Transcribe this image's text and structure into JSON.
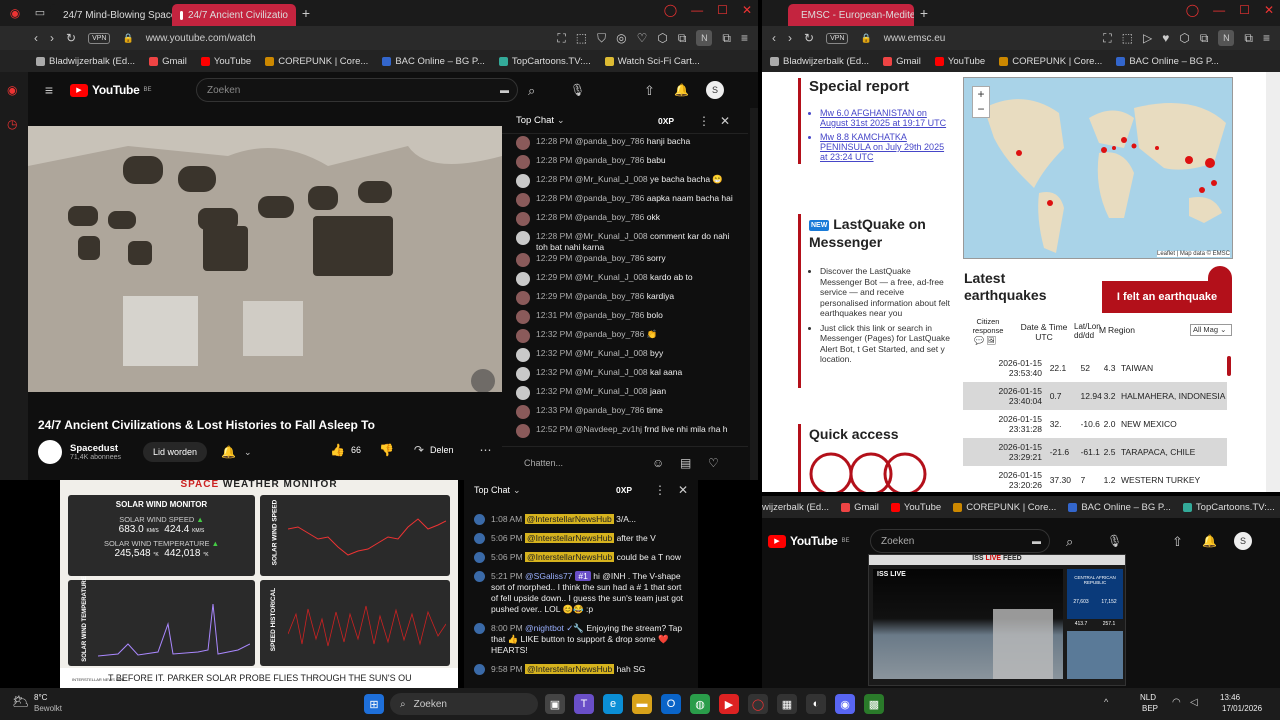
{
  "left_browser": {
    "tabs": [
      {
        "label": "24/7 Mind-Blowing Space"
      },
      {
        "label": "24/7 Ancient Civilizatio"
      }
    ],
    "url": "www.youtube.com/watch",
    "vpn": "VPN",
    "bookmarks": [
      "Bladwijzerbalk (Ed...",
      "Gmail",
      "YouTube",
      "COREPUNK | Core...",
      "BAC Online – BG P...",
      "TopCartoons.TV:...",
      "Watch Sci-Fi Cart..."
    ],
    "yt": {
      "logo": "YouTube",
      "region": "BE",
      "search_placeholder": "Zoeken",
      "avatar": "S",
      "video_title": "24/7 Ancient Civilizations & Lost Histories to Fall Asleep To",
      "channel": "Spacedust",
      "subscribers": "71,4K abonnees",
      "join": "Lid worden",
      "likes": "66",
      "share": "Delen",
      "chat": {
        "header": "Top Chat",
        "points": "0XP",
        "input_placeholder": "Chatten...",
        "messages": [
          {
            "time": "12:28 PM",
            "user": "@panda_boy_786",
            "text": "hanji bacha"
          },
          {
            "time": "12:28 PM",
            "user": "@panda_boy_786",
            "text": "babu"
          },
          {
            "time": "12:28 PM",
            "user": "@Mr_Kunal_J_008",
            "text": "ye bacha bacha 😁"
          },
          {
            "time": "12:28 PM",
            "user": "@panda_boy_786",
            "text": "aapka naam bacha hai"
          },
          {
            "time": "12:28 PM",
            "user": "@panda_boy_786",
            "text": "okk"
          },
          {
            "time": "12:28 PM",
            "user": "@Mr_Kunal_J_008",
            "text": "comment kar do nahi toh bat nahi karna"
          },
          {
            "time": "12:29 PM",
            "user": "@panda_boy_786",
            "text": "sorry"
          },
          {
            "time": "12:29 PM",
            "user": "@Mr_Kunal_J_008",
            "text": "kardo ab to"
          },
          {
            "time": "12:29 PM",
            "user": "@panda_boy_786",
            "text": "kardiya"
          },
          {
            "time": "12:31 PM",
            "user": "@panda_boy_786",
            "text": "bolo"
          },
          {
            "time": "12:32 PM",
            "user": "@panda_boy_786",
            "text": "👏"
          },
          {
            "time": "12:32 PM",
            "user": "@Mr_Kunal_J_008",
            "text": "byy"
          },
          {
            "time": "12:32 PM",
            "user": "@Mr_Kunal_J_008",
            "text": "kal aana"
          },
          {
            "time": "12:32 PM",
            "user": "@Mr_Kunal_J_008",
            "text": "jaan"
          },
          {
            "time": "12:33 PM",
            "user": "@panda_boy_786",
            "text": "time"
          },
          {
            "time": "12:52 PM",
            "user": "@Navdeep_zv1hj",
            "text": "frnd live nhi mila rha h"
          }
        ]
      }
    }
  },
  "space_monitor": {
    "title_a": "SPACE",
    "title_b": " WEATHER MONITOR",
    "solar_wind_monitor": "SOLAR WIND MONITOR",
    "speed_label": "SOLAR WIND SPEED",
    "speed_a": "683.0",
    "speed_b": "424.4",
    "speed_unit": "KM/S",
    "temp_label": "SOLAR WIND TEMPERATURE",
    "temp_a": "245,548",
    "temp_b": "442,018",
    "temp_unit": "°K",
    "chart1_axis": "SOLAR WIND SPEED",
    "chart1_yticks": [
      "700",
      "650",
      "600",
      "550",
      "500",
      "450",
      "400",
      "350"
    ],
    "chart1_xticks": [
      "Jan 5",
      "Jan 7",
      "Jan 9",
      "Jan 11"
    ],
    "chart2_axis": "SOLAR WIND TEMPERATURE",
    "chart2_xticks": [
      "Jan 5",
      "Jan 7",
      "Jan 9",
      "Jan 11"
    ],
    "chart3_axis": "SPEED HISTORICAL",
    "chart3_yticks": [
      "600",
      "500",
      "400",
      "300",
      "200"
    ],
    "chart3_xticks": [
      "1964",
      "1971",
      "1978",
      "1985",
      "1992",
      "1999",
      "2006",
      "2013",
      "2020"
    ],
    "ticker": "T BEFORE IT.   PARKER SOLAR PROBE FLIES THROUGH THE SUN'S OU",
    "brand": "INTERSTELLAR NEWS HUB"
  },
  "bottom_chat": {
    "header": "Top Chat",
    "points": "0XP",
    "messages": [
      {
        "time": "1:08 AM",
        "user": "@InterstellarNewsHub",
        "text": "3/A..."
      },
      {
        "time": "5:06 PM",
        "user": "@InterstellarNewsHub",
        "text": "after the V"
      },
      {
        "time": "5:06 PM",
        "user": "@InterstellarNewsHub",
        "text": "could be a T now"
      },
      {
        "time": "5:21 PM",
        "user": "@SGaliss77",
        "badge": "#1",
        "text": "hi @INH . The V-shape sort of morphed.. I think the sun had a # 1 that sort of fell upside down.. I guess the sun's team just got pushed over.. LOL 😊😂 :p"
      },
      {
        "time": "8:00 PM",
        "user": "@nightbot ✓🔧",
        "text": "Enjoying the stream? Tap that 👍 LIKE button to support & drop some ❤️ HEARTS!"
      },
      {
        "time": "9:58 PM",
        "user": "@InterstellarNewsHub",
        "text": "hah SG"
      }
    ]
  },
  "right_browser": {
    "tab": "EMSC - European-Mediter",
    "url": "www.emsc.eu",
    "vpn": "VPN",
    "bookmarks": [
      "Bladwijzerbalk (Ed...",
      "Gmail",
      "YouTube",
      "COREPUNK | Core...",
      "BAC Online – BG P..."
    ],
    "special_report": "Special report",
    "report_links": [
      "Mw 6.0 AFGHANISTAN on August 31st 2025 at 19:17 UTC",
      "Mw 8.8 KAMCHATKA PENINSULA on July 29th 2025 at 23:24 UTC"
    ],
    "lastquake_title": "LastQuake on Messenger",
    "new_badge": "NEW",
    "lastquake_b1": "Discover the LastQuake Messenger Bot — a free, ad-free service — and receive personalised information about felt earthquakes near you",
    "lastquake_b2": "Just click this link or search in Messenger (Pages) for LastQuake Alert Bot, t Get Started, and set y location.",
    "quick_access": "Quick access",
    "map_zoom": "+",
    "map_attrib": "Leaflet | Map data © EMSC",
    "latest": "Latest earthquakes",
    "felt_button": "I felt an earthquake",
    "col_citizen": "Citizen response",
    "col_datetime": "Date & Time UTC",
    "col_latlon": "Lat/Lon dd/dd",
    "col_mag": "M",
    "col_region": "Region",
    "mag_filter": "All Mag",
    "quakes": [
      {
        "date": "2026-01-15",
        "time": "23:53:40",
        "lat": "22.1",
        "lon": "52",
        "mag": "4.3",
        "region": "TAIWAN"
      },
      {
        "date": "2026-01-15",
        "time": "23:40:04",
        "lat": "0.7",
        "lon": "12.94",
        "mag": "3.2",
        "region": "HALMAHERA, INDONESIA"
      },
      {
        "date": "2026-01-15",
        "time": "23:31:28",
        "lat": "32.",
        "lon": "-10.6",
        "mag": "2.0",
        "region": "NEW MEXICO"
      },
      {
        "date": "2026-01-15",
        "time": "23:29:21",
        "lat": "-21.6",
        "lon": "-61.1",
        "mag": "2.5",
        "region": "TARAPACA, CHILE"
      },
      {
        "date": "2026-01-15",
        "time": "23:20:26",
        "lat": "37.30",
        "lon": "7",
        "mag": "1.2",
        "region": "WESTERN TURKEY"
      }
    ]
  },
  "iss_window": {
    "bookmarks": [
      "wijzerbalk (Ed...",
      "Gmail",
      "YouTube",
      "COREPUNK | Core...",
      "BAC Online – BG P...",
      "TopCartoons.TV:..."
    ],
    "logo": "YouTube",
    "region": "BE",
    "search_placeholder": "Zoeken",
    "avatar": "S",
    "banner_a": "ISS ",
    "banner_b": "LIVE",
    "banner_c": " FEED",
    "iss_live": "ISS LIVE",
    "location": "CENTRAL AFRICAN REPUBLIC",
    "stat_a": "27,603",
    "stat_b": "17,152",
    "stat_c": "413.7",
    "stat_d": "257.1"
  },
  "taskbar": {
    "weather_temp": "8°C",
    "weather_desc": "Bewolkt",
    "search": "Zoeken",
    "lang_a": "NLD",
    "lang_b": "BEP",
    "time": "13:46",
    "date": "17/01/2026"
  },
  "colors": {
    "yt_red": "#ff0000",
    "emsc_red": "#b3101a",
    "tab_active": "#c4243f",
    "chat_yellow": "#d6b31e"
  }
}
